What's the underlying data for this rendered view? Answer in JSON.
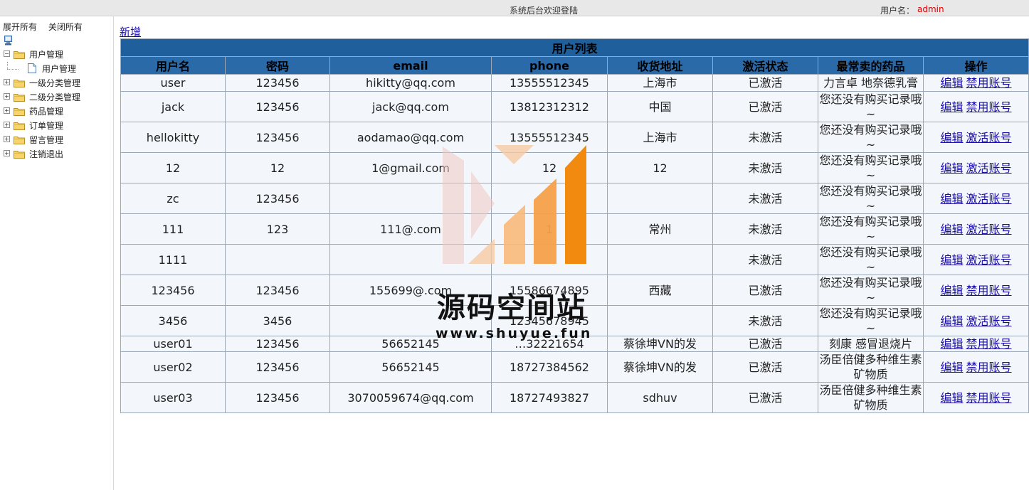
{
  "header": {
    "welcome": "系统后台欢迎登陆",
    "user_label": "用户名：",
    "username": "admin"
  },
  "sidebar": {
    "expand_all": "展开所有",
    "collapse_all": "关闭所有",
    "items": [
      {
        "label": "用户管理",
        "expanded": true,
        "children": [
          "用户管理"
        ]
      },
      {
        "label": "一级分类管理"
      },
      {
        "label": "二级分类管理"
      },
      {
        "label": "药品管理"
      },
      {
        "label": "订单管理"
      },
      {
        "label": "留言管理"
      },
      {
        "label": "注销退出"
      }
    ]
  },
  "main": {
    "add_label": "新增",
    "table": {
      "caption": "用户列表",
      "columns": [
        "用户名",
        "密码",
        "email",
        "phone",
        "收货地址",
        "激活状态",
        "最常卖的药品",
        "操作"
      ],
      "rows": [
        {
          "username": "user",
          "password": "123456",
          "email": "hikitty@qq.com",
          "phone": "13555512345",
          "address": "上海市",
          "status": "已激活",
          "top_drug": "力言卓 地奈德乳膏",
          "edit": "编辑",
          "action": "禁用账号"
        },
        {
          "username": "jack",
          "password": "123456",
          "email": "jack@qq.com",
          "phone": "13812312312",
          "address": "中国",
          "status": "已激活",
          "top_drug": "您还没有购买记录哦~",
          "edit": "编辑",
          "action": "禁用账号"
        },
        {
          "username": "hellokitty",
          "password": "123456",
          "email": "aodamao@qq.com",
          "phone": "13555512345",
          "address": "上海市",
          "status": "未激活",
          "top_drug": "您还没有购买记录哦~",
          "edit": "编辑",
          "action": "激活账号"
        },
        {
          "username": "12",
          "password": "12",
          "email": "1@gmail.com",
          "phone": "12",
          "address": "12",
          "status": "未激活",
          "top_drug": "您还没有购买记录哦~",
          "edit": "编辑",
          "action": "激活账号"
        },
        {
          "username": "zc",
          "password": "123456",
          "email": "",
          "phone": "",
          "address": "",
          "status": "未激活",
          "top_drug": "您还没有购买记录哦~",
          "edit": "编辑",
          "action": "激活账号"
        },
        {
          "username": "111",
          "password": "123",
          "email": "111@.com",
          "phone": "1",
          "address": "常州",
          "status": "未激活",
          "top_drug": "您还没有购买记录哦~",
          "edit": "编辑",
          "action": "激活账号"
        },
        {
          "username": "1111",
          "password": "",
          "email": "",
          "phone": "",
          "address": "",
          "status": "未激活",
          "top_drug": "您还没有购买记录哦~",
          "edit": "编辑",
          "action": "激活账号"
        },
        {
          "username": "123456",
          "password": "123456",
          "email": "155699@.com",
          "phone": "15586674895",
          "address": "西藏",
          "status": "已激活",
          "top_drug": "您还没有购买记录哦~",
          "edit": "编辑",
          "action": "禁用账号"
        },
        {
          "username": "3456",
          "password": "3456",
          "email": "",
          "phone": "12345678945",
          "address": "",
          "status": "未激活",
          "top_drug": "您还没有购买记录哦~",
          "edit": "编辑",
          "action": "激活账号"
        },
        {
          "username": "user01",
          "password": "123456",
          "email": "56652145",
          "phone": "…32221654",
          "address": "蔡徐坤VN的发",
          "status": "已激活",
          "top_drug": "刻康 感冒退烧片",
          "edit": "编辑",
          "action": "禁用账号"
        },
        {
          "username": "user02",
          "password": "123456",
          "email": "56652145",
          "phone": "18727384562",
          "address": "蔡徐坤VN的发",
          "status": "已激活",
          "top_drug": "汤臣倍健多种维生素矿物质",
          "edit": "编辑",
          "action": "禁用账号"
        },
        {
          "username": "user03",
          "password": "123456",
          "email": "3070059674@qq.com",
          "phone": "18727493827",
          "address": "sdhuv",
          "status": "已激活",
          "top_drug": "汤臣倍健多种维生素矿物质",
          "edit": "编辑",
          "action": "禁用账号"
        }
      ]
    }
  },
  "watermark": {
    "title": "源码空间站",
    "url": "www.shuyue.fun"
  }
}
